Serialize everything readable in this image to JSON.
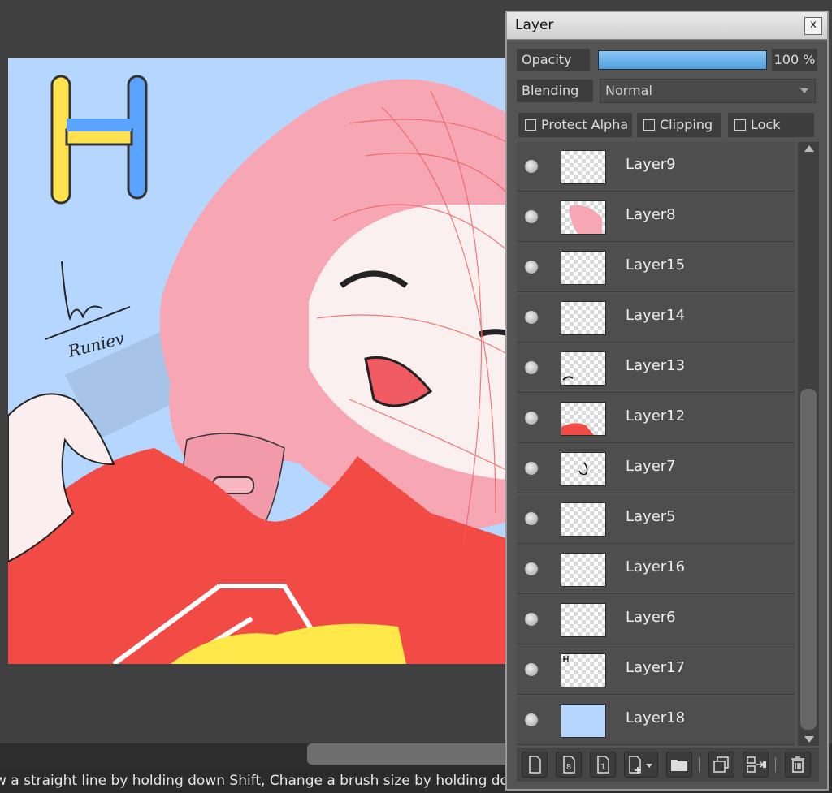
{
  "status": {
    "message": "w a straight line by holding down Shift, Change a brush size by holding down"
  },
  "canvas": {
    "signature_text": "Runiev"
  },
  "layer_panel": {
    "title": "Layer",
    "close_label": "x",
    "opacity_label": "Opacity",
    "opacity_value": "100 %",
    "blending_label": "Blending",
    "blending_value": "Normal",
    "protect_alpha_label": "Protect Alpha",
    "clipping_label": "Clipping",
    "lock_label": "Lock",
    "layers": [
      {
        "name": "Layer9"
      },
      {
        "name": "Layer8"
      },
      {
        "name": "Layer15"
      },
      {
        "name": "Layer14"
      },
      {
        "name": "Layer13"
      },
      {
        "name": "Layer12"
      },
      {
        "name": "Layer7"
      },
      {
        "name": "Layer5"
      },
      {
        "name": "Layer16"
      },
      {
        "name": "Layer6"
      },
      {
        "name": "Layer17"
      },
      {
        "name": "Layer18"
      }
    ],
    "toolbar": {
      "new_layer_icon": "new-layer-icon",
      "new_layer_8bit_icon": "new-8bit-layer-icon",
      "new_layer_1bit_icon": "new-1bit-layer-icon",
      "add_layer_menu_icon": "add-layer-menu-icon",
      "new_folder_icon": "folder-icon",
      "duplicate_icon": "duplicate-layer-icon",
      "merge_icon": "merge-down-icon",
      "delete_icon": "trash-icon"
    }
  },
  "colors": {
    "canvas_bg": "#b5d6ff",
    "opacity_bar": "#5aaaea",
    "shirt_red": "#f24a45",
    "hair_pink": "#f7a7b4"
  }
}
